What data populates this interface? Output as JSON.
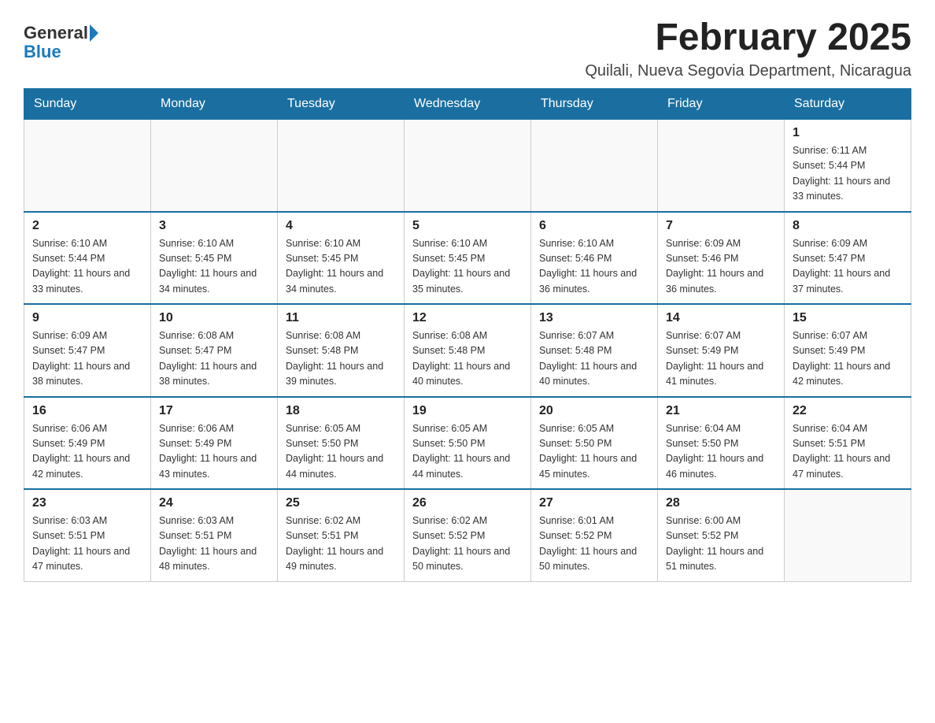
{
  "logo": {
    "general": "General",
    "blue": "Blue"
  },
  "title": "February 2025",
  "location": "Quilali, Nueva Segovia Department, Nicaragua",
  "weekdays": [
    "Sunday",
    "Monday",
    "Tuesday",
    "Wednesday",
    "Thursday",
    "Friday",
    "Saturday"
  ],
  "weeks": [
    [
      {
        "day": "",
        "sunrise": "",
        "sunset": "",
        "daylight": ""
      },
      {
        "day": "",
        "sunrise": "",
        "sunset": "",
        "daylight": ""
      },
      {
        "day": "",
        "sunrise": "",
        "sunset": "",
        "daylight": ""
      },
      {
        "day": "",
        "sunrise": "",
        "sunset": "",
        "daylight": ""
      },
      {
        "day": "",
        "sunrise": "",
        "sunset": "",
        "daylight": ""
      },
      {
        "day": "",
        "sunrise": "",
        "sunset": "",
        "daylight": ""
      },
      {
        "day": "1",
        "sunrise": "Sunrise: 6:11 AM",
        "sunset": "Sunset: 5:44 PM",
        "daylight": "Daylight: 11 hours and 33 minutes."
      }
    ],
    [
      {
        "day": "2",
        "sunrise": "Sunrise: 6:10 AM",
        "sunset": "Sunset: 5:44 PM",
        "daylight": "Daylight: 11 hours and 33 minutes."
      },
      {
        "day": "3",
        "sunrise": "Sunrise: 6:10 AM",
        "sunset": "Sunset: 5:45 PM",
        "daylight": "Daylight: 11 hours and 34 minutes."
      },
      {
        "day": "4",
        "sunrise": "Sunrise: 6:10 AM",
        "sunset": "Sunset: 5:45 PM",
        "daylight": "Daylight: 11 hours and 34 minutes."
      },
      {
        "day": "5",
        "sunrise": "Sunrise: 6:10 AM",
        "sunset": "Sunset: 5:45 PM",
        "daylight": "Daylight: 11 hours and 35 minutes."
      },
      {
        "day": "6",
        "sunrise": "Sunrise: 6:10 AM",
        "sunset": "Sunset: 5:46 PM",
        "daylight": "Daylight: 11 hours and 36 minutes."
      },
      {
        "day": "7",
        "sunrise": "Sunrise: 6:09 AM",
        "sunset": "Sunset: 5:46 PM",
        "daylight": "Daylight: 11 hours and 36 minutes."
      },
      {
        "day": "8",
        "sunrise": "Sunrise: 6:09 AM",
        "sunset": "Sunset: 5:47 PM",
        "daylight": "Daylight: 11 hours and 37 minutes."
      }
    ],
    [
      {
        "day": "9",
        "sunrise": "Sunrise: 6:09 AM",
        "sunset": "Sunset: 5:47 PM",
        "daylight": "Daylight: 11 hours and 38 minutes."
      },
      {
        "day": "10",
        "sunrise": "Sunrise: 6:08 AM",
        "sunset": "Sunset: 5:47 PM",
        "daylight": "Daylight: 11 hours and 38 minutes."
      },
      {
        "day": "11",
        "sunrise": "Sunrise: 6:08 AM",
        "sunset": "Sunset: 5:48 PM",
        "daylight": "Daylight: 11 hours and 39 minutes."
      },
      {
        "day": "12",
        "sunrise": "Sunrise: 6:08 AM",
        "sunset": "Sunset: 5:48 PM",
        "daylight": "Daylight: 11 hours and 40 minutes."
      },
      {
        "day": "13",
        "sunrise": "Sunrise: 6:07 AM",
        "sunset": "Sunset: 5:48 PM",
        "daylight": "Daylight: 11 hours and 40 minutes."
      },
      {
        "day": "14",
        "sunrise": "Sunrise: 6:07 AM",
        "sunset": "Sunset: 5:49 PM",
        "daylight": "Daylight: 11 hours and 41 minutes."
      },
      {
        "day": "15",
        "sunrise": "Sunrise: 6:07 AM",
        "sunset": "Sunset: 5:49 PM",
        "daylight": "Daylight: 11 hours and 42 minutes."
      }
    ],
    [
      {
        "day": "16",
        "sunrise": "Sunrise: 6:06 AM",
        "sunset": "Sunset: 5:49 PM",
        "daylight": "Daylight: 11 hours and 42 minutes."
      },
      {
        "day": "17",
        "sunrise": "Sunrise: 6:06 AM",
        "sunset": "Sunset: 5:49 PM",
        "daylight": "Daylight: 11 hours and 43 minutes."
      },
      {
        "day": "18",
        "sunrise": "Sunrise: 6:05 AM",
        "sunset": "Sunset: 5:50 PM",
        "daylight": "Daylight: 11 hours and 44 minutes."
      },
      {
        "day": "19",
        "sunrise": "Sunrise: 6:05 AM",
        "sunset": "Sunset: 5:50 PM",
        "daylight": "Daylight: 11 hours and 44 minutes."
      },
      {
        "day": "20",
        "sunrise": "Sunrise: 6:05 AM",
        "sunset": "Sunset: 5:50 PM",
        "daylight": "Daylight: 11 hours and 45 minutes."
      },
      {
        "day": "21",
        "sunrise": "Sunrise: 6:04 AM",
        "sunset": "Sunset: 5:50 PM",
        "daylight": "Daylight: 11 hours and 46 minutes."
      },
      {
        "day": "22",
        "sunrise": "Sunrise: 6:04 AM",
        "sunset": "Sunset: 5:51 PM",
        "daylight": "Daylight: 11 hours and 47 minutes."
      }
    ],
    [
      {
        "day": "23",
        "sunrise": "Sunrise: 6:03 AM",
        "sunset": "Sunset: 5:51 PM",
        "daylight": "Daylight: 11 hours and 47 minutes."
      },
      {
        "day": "24",
        "sunrise": "Sunrise: 6:03 AM",
        "sunset": "Sunset: 5:51 PM",
        "daylight": "Daylight: 11 hours and 48 minutes."
      },
      {
        "day": "25",
        "sunrise": "Sunrise: 6:02 AM",
        "sunset": "Sunset: 5:51 PM",
        "daylight": "Daylight: 11 hours and 49 minutes."
      },
      {
        "day": "26",
        "sunrise": "Sunrise: 6:02 AM",
        "sunset": "Sunset: 5:52 PM",
        "daylight": "Daylight: 11 hours and 50 minutes."
      },
      {
        "day": "27",
        "sunrise": "Sunrise: 6:01 AM",
        "sunset": "Sunset: 5:52 PM",
        "daylight": "Daylight: 11 hours and 50 minutes."
      },
      {
        "day": "28",
        "sunrise": "Sunrise: 6:00 AM",
        "sunset": "Sunset: 5:52 PM",
        "daylight": "Daylight: 11 hours and 51 minutes."
      },
      {
        "day": "",
        "sunrise": "",
        "sunset": "",
        "daylight": ""
      }
    ]
  ]
}
